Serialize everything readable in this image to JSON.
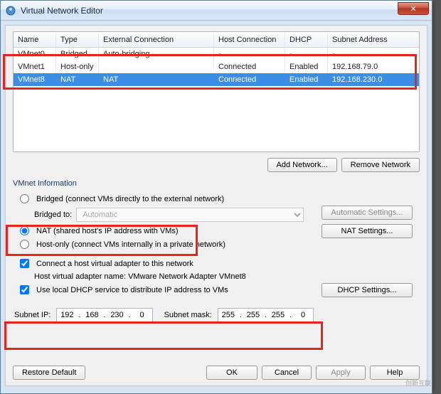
{
  "window": {
    "title": "Virtual Network Editor",
    "close": "✕"
  },
  "grid": {
    "headers": {
      "name": "Name",
      "type": "Type",
      "ext": "External Connection",
      "host": "Host Connection",
      "dhcp": "DHCP",
      "subnet": "Subnet Address"
    },
    "rows": [
      {
        "name": "VMnet0",
        "type": "Bridged",
        "ext": "Auto-bridging",
        "host": "-",
        "dhcp": "-",
        "subnet": "-"
      },
      {
        "name": "VMnet1",
        "type": "Host-only",
        "ext": "",
        "host": "Connected",
        "dhcp": "Enabled",
        "subnet": "192.168.79.0"
      },
      {
        "name": "VMnet8",
        "type": "NAT",
        "ext": "NAT",
        "host": "Connected",
        "dhcp": "Enabled",
        "subnet": "192.168.230.0"
      }
    ]
  },
  "buttons": {
    "add_network": "Add Network...",
    "remove_network": "Remove Network",
    "automatic_settings": "Automatic Settings...",
    "nat_settings": "NAT Settings...",
    "dhcp_settings": "DHCP Settings...",
    "restore_default": "Restore Default",
    "ok": "OK",
    "cancel": "Cancel",
    "apply": "Apply",
    "help": "Help"
  },
  "info": {
    "group_label": "VMnet Information",
    "bridged_label": "Bridged (connect VMs directly to the external network)",
    "bridged_to": "Bridged to:",
    "bridged_to_value": "Automatic",
    "nat_label": "NAT (shared host's IP address with VMs)",
    "hostonly_label": "Host-only (connect VMs internally in a private network)",
    "connect_adapter": "Connect a host virtual adapter to this network",
    "adapter_name_label": "Host virtual adapter name: VMware Network Adapter VMnet8",
    "use_dhcp": "Use local DHCP service to distribute IP address to VMs",
    "subnet_ip_label": "Subnet IP:",
    "subnet_ip": [
      "192",
      "168",
      "230",
      "0"
    ],
    "subnet_mask_label": "Subnet mask:",
    "subnet_mask": [
      "255",
      "255",
      "255",
      "0"
    ]
  },
  "watermark": "创新互联"
}
